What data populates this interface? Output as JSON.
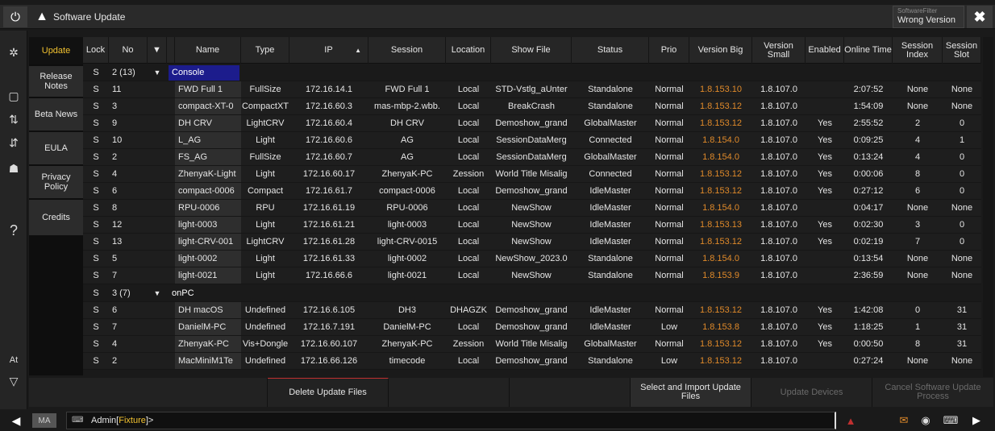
{
  "title_bar": {
    "title": "Software Update",
    "filter_label": "SoftwareFilter",
    "filter_value": "Wrong Version"
  },
  "left_bar": {
    "at_label": "At",
    "help_label": "?"
  },
  "side_tabs": [
    {
      "label": "Update",
      "active": true
    },
    {
      "label": "Release Notes",
      "active": false
    },
    {
      "label": "Beta News",
      "active": false
    },
    {
      "label": "EULA",
      "active": false
    },
    {
      "label": "Privacy Policy",
      "active": false
    },
    {
      "label": "Credits",
      "active": false
    }
  ],
  "columns": {
    "lock": "Lock",
    "no": "No",
    "name": "Name",
    "type": "Type",
    "ip": "IP",
    "session": "Session",
    "location": "Location",
    "show_file": "Show File",
    "status": "Status",
    "prio": "Prio",
    "version_big": "Version Big",
    "version_small": "Version Small",
    "enabled": "Enabled",
    "online_time": "Online Time",
    "session_index": "Session Index",
    "session_slot": "Session Slot"
  },
  "groups": [
    {
      "lock": "S",
      "no": "2 (13)",
      "name": "Console"
    },
    {
      "lock": "S",
      "no": "3 (7)",
      "name": "onPC"
    }
  ],
  "rows_console": [
    {
      "lock": "S",
      "no": "11",
      "name": "FWD Full 1",
      "type": "FullSize",
      "ip": "172.16.14.1",
      "session": "FWD Full 1",
      "location": "Local",
      "show_file": "STD-Vstlg_aUnter",
      "status": "Standalone",
      "prio": "Normal",
      "version_big": "1.8.153.10",
      "version_small": "1.8.107.0",
      "enabled": "",
      "online_time": "2:07:52",
      "session_index": "None",
      "session_slot": "None"
    },
    {
      "lock": "S",
      "no": "3",
      "name": "compact-XT-0",
      "type": "CompactXT",
      "ip": "172.16.60.3",
      "session": "mas-mbp-2.wbb.",
      "location": "Local",
      "show_file": "BreakCrash",
      "status": "Standalone",
      "prio": "Normal",
      "version_big": "1.8.153.12",
      "version_small": "1.8.107.0",
      "enabled": "",
      "online_time": "1:54:09",
      "session_index": "None",
      "session_slot": "None"
    },
    {
      "lock": "S",
      "no": "9",
      "name": "DH CRV",
      "type": "LightCRV",
      "ip": "172.16.60.4",
      "session": "DH CRV",
      "location": "Local",
      "show_file": "Demoshow_grand",
      "status": "GlobalMaster",
      "prio": "Normal",
      "version_big": "1.8.153.12",
      "version_small": "1.8.107.0",
      "enabled": "Yes",
      "online_time": "2:55:52",
      "session_index": "2",
      "session_slot": "0"
    },
    {
      "lock": "S",
      "no": "10",
      "name": "L_AG",
      "type": "Light",
      "ip": "172.16.60.6",
      "session": "AG",
      "location": "Local",
      "show_file": "SessionDataMerg",
      "status": "Connected",
      "prio": "Normal",
      "version_big": "1.8.154.0",
      "version_small": "1.8.107.0",
      "enabled": "Yes",
      "online_time": "0:09:25",
      "session_index": "4",
      "session_slot": "1"
    },
    {
      "lock": "S",
      "no": "2",
      "name": "FS_AG",
      "type": "FullSize",
      "ip": "172.16.60.7",
      "session": "AG",
      "location": "Local",
      "show_file": "SessionDataMerg",
      "status": "GlobalMaster",
      "prio": "Normal",
      "version_big": "1.8.154.0",
      "version_small": "1.8.107.0",
      "enabled": "Yes",
      "online_time": "0:13:24",
      "session_index": "4",
      "session_slot": "0"
    },
    {
      "lock": "S",
      "no": "4",
      "name": "ZhenyaK-Light",
      "type": "Light",
      "ip": "172.16.60.17",
      "session": "ZhenyaK-PC",
      "location": "Zession",
      "show_file": "World Title Misalig",
      "status": "Connected",
      "prio": "Normal",
      "version_big": "1.8.153.12",
      "version_small": "1.8.107.0",
      "enabled": "Yes",
      "online_time": "0:00:06",
      "session_index": "8",
      "session_slot": "0"
    },
    {
      "lock": "S",
      "no": "6",
      "name": "compact-0006",
      "type": "Compact",
      "ip": "172.16.61.7",
      "session": "compact-0006",
      "location": "Local",
      "show_file": "Demoshow_grand",
      "status": "IdleMaster",
      "prio": "Normal",
      "version_big": "1.8.153.12",
      "version_small": "1.8.107.0",
      "enabled": "Yes",
      "online_time": "0:27:12",
      "session_index": "6",
      "session_slot": "0"
    },
    {
      "lock": "S",
      "no": "8",
      "name": "RPU-0006",
      "type": "RPU",
      "ip": "172.16.61.19",
      "session": "RPU-0006",
      "location": "Local",
      "show_file": "NewShow",
      "status": "IdleMaster",
      "prio": "Normal",
      "version_big": "1.8.154.0",
      "version_small": "1.8.107.0",
      "enabled": "",
      "online_time": "0:04:17",
      "session_index": "None",
      "session_slot": "None"
    },
    {
      "lock": "S",
      "no": "12",
      "name": "light-0003",
      "type": "Light",
      "ip": "172.16.61.21",
      "session": "light-0003",
      "location": "Local",
      "show_file": "NewShow",
      "status": "IdleMaster",
      "prio": "Normal",
      "version_big": "1.8.153.13",
      "version_small": "1.8.107.0",
      "enabled": "Yes",
      "online_time": "0:02:30",
      "session_index": "3",
      "session_slot": "0"
    },
    {
      "lock": "S",
      "no": "13",
      "name": "light-CRV-001",
      "type": "LightCRV",
      "ip": "172.16.61.28",
      "session": "light-CRV-0015",
      "location": "Local",
      "show_file": "NewShow",
      "status": "IdleMaster",
      "prio": "Normal",
      "version_big": "1.8.153.12",
      "version_small": "1.8.107.0",
      "enabled": "Yes",
      "online_time": "0:02:19",
      "session_index": "7",
      "session_slot": "0"
    },
    {
      "lock": "S",
      "no": "5",
      "name": "light-0002",
      "type": "Light",
      "ip": "172.16.61.33",
      "session": "light-0002",
      "location": "Local",
      "show_file": "NewShow_2023.0",
      "status": "Standalone",
      "prio": "Normal",
      "version_big": "1.8.154.0",
      "version_small": "1.8.107.0",
      "enabled": "",
      "online_time": "0:13:54",
      "session_index": "None",
      "session_slot": "None"
    },
    {
      "lock": "S",
      "no": "7",
      "name": "light-0021",
      "type": "Light",
      "ip": "172.16.66.6",
      "session": "light-0021",
      "location": "Local",
      "show_file": "NewShow",
      "status": "Standalone",
      "prio": "Normal",
      "version_big": "1.8.153.9",
      "version_small": "1.8.107.0",
      "enabled": "",
      "online_time": "2:36:59",
      "session_index": "None",
      "session_slot": "None"
    }
  ],
  "rows_onpc": [
    {
      "lock": "S",
      "no": "6",
      "name": "DH macOS",
      "type": "Undefined",
      "ip": "172.16.6.105",
      "session": "DH3",
      "location": "DHAGZK",
      "show_file": "Demoshow_grand",
      "status": "IdleMaster",
      "prio": "Normal",
      "version_big": "1.8.153.12",
      "version_small": "1.8.107.0",
      "enabled": "Yes",
      "online_time": "1:42:08",
      "session_index": "0",
      "session_slot": "31"
    },
    {
      "lock": "S",
      "no": "7",
      "name": "DanielM-PC",
      "type": "Undefined",
      "ip": "172.16.7.191",
      "session": "DanielM-PC",
      "location": "Local",
      "show_file": "Demoshow_grand",
      "status": "IdleMaster",
      "prio": "Low",
      "version_big": "1.8.153.8",
      "version_small": "1.8.107.0",
      "enabled": "Yes",
      "online_time": "1:18:25",
      "session_index": "1",
      "session_slot": "31"
    },
    {
      "lock": "S",
      "no": "4",
      "name": "ZhenyaK-PC",
      "type": "Vis+Dongle",
      "ip": "172.16.60.107",
      "session": "ZhenyaK-PC",
      "location": "Zession",
      "show_file": "World Title Misalig",
      "status": "GlobalMaster",
      "prio": "Normal",
      "version_big": "1.8.153.12",
      "version_small": "1.8.107.0",
      "enabled": "Yes",
      "online_time": "0:00:50",
      "session_index": "8",
      "session_slot": "31"
    },
    {
      "lock": "S",
      "no": "2",
      "name": "MacMiniM1Te",
      "type": "Undefined",
      "ip": "172.16.66.126",
      "session": "timecode",
      "location": "Local",
      "show_file": "Demoshow_grand",
      "status": "Standalone",
      "prio": "Low",
      "version_big": "1.8.153.12",
      "version_small": "1.8.107.0",
      "enabled": "",
      "online_time": "0:27:24",
      "session_index": "None",
      "session_slot": "None"
    }
  ],
  "bottom_buttons": {
    "delete": "Delete Update Files",
    "select_import": "Select and Import Update Files",
    "update_devices": "Update Devices",
    "cancel": "Cancel Software Update Process"
  },
  "command_line": {
    "ma_label": "MA",
    "prefix": "Admin[",
    "highlight": "Fixture",
    "suffix": "]>"
  },
  "colors": {
    "accent": "#f2c230",
    "version_big": "#e08a2a",
    "console_group": "#1c1c8c"
  }
}
